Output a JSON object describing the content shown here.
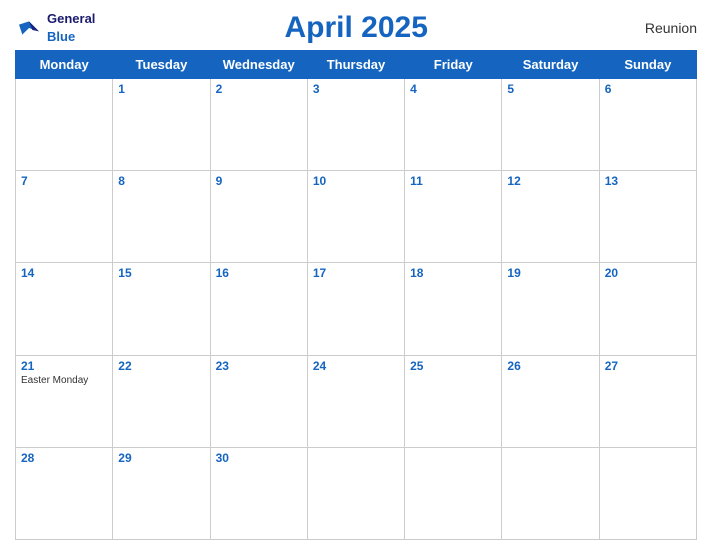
{
  "header": {
    "logo": {
      "general": "General",
      "blue": "Blue",
      "bird_unicode": "🐦"
    },
    "title": "April 2025",
    "region": "Reunion"
  },
  "weekdays": [
    "Monday",
    "Tuesday",
    "Wednesday",
    "Thursday",
    "Friday",
    "Saturday",
    "Sunday"
  ],
  "weeks": [
    [
      {
        "day": "",
        "holiday": ""
      },
      {
        "day": "1",
        "holiday": ""
      },
      {
        "day": "2",
        "holiday": ""
      },
      {
        "day": "3",
        "holiday": ""
      },
      {
        "day": "4",
        "holiday": ""
      },
      {
        "day": "5",
        "holiday": ""
      },
      {
        "day": "6",
        "holiday": ""
      }
    ],
    [
      {
        "day": "7",
        "holiday": ""
      },
      {
        "day": "8",
        "holiday": ""
      },
      {
        "day": "9",
        "holiday": ""
      },
      {
        "day": "10",
        "holiday": ""
      },
      {
        "day": "11",
        "holiday": ""
      },
      {
        "day": "12",
        "holiday": ""
      },
      {
        "day": "13",
        "holiday": ""
      }
    ],
    [
      {
        "day": "14",
        "holiday": ""
      },
      {
        "day": "15",
        "holiday": ""
      },
      {
        "day": "16",
        "holiday": ""
      },
      {
        "day": "17",
        "holiday": ""
      },
      {
        "day": "18",
        "holiday": ""
      },
      {
        "day": "19",
        "holiday": ""
      },
      {
        "day": "20",
        "holiday": ""
      }
    ],
    [
      {
        "day": "21",
        "holiday": "Easter Monday"
      },
      {
        "day": "22",
        "holiday": ""
      },
      {
        "day": "23",
        "holiday": ""
      },
      {
        "day": "24",
        "holiday": ""
      },
      {
        "day": "25",
        "holiday": ""
      },
      {
        "day": "26",
        "holiday": ""
      },
      {
        "day": "27",
        "holiday": ""
      }
    ],
    [
      {
        "day": "28",
        "holiday": ""
      },
      {
        "day": "29",
        "holiday": ""
      },
      {
        "day": "30",
        "holiday": ""
      },
      {
        "day": "",
        "holiday": ""
      },
      {
        "day": "",
        "holiday": ""
      },
      {
        "day": "",
        "holiday": ""
      },
      {
        "day": "",
        "holiday": ""
      }
    ]
  ]
}
